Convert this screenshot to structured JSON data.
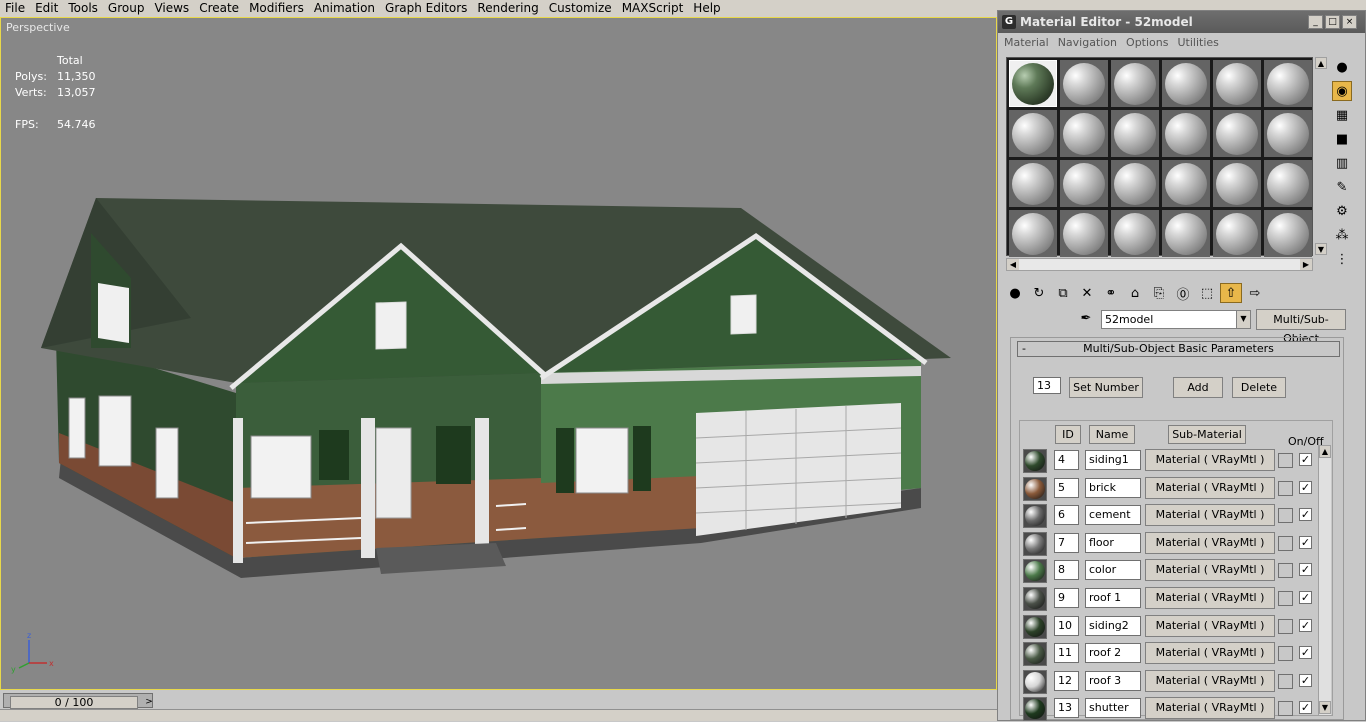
{
  "menubar": {
    "items": [
      "File",
      "Edit",
      "Tools",
      "Group",
      "Views",
      "Create",
      "Modifiers",
      "Animation",
      "Graph Editors",
      "Rendering",
      "Customize",
      "MAXScript",
      "Help"
    ]
  },
  "viewport": {
    "label": "Perspective",
    "stats": {
      "header": "Total",
      "polys_label": "Polys:",
      "polys": "11,350",
      "verts_label": "Verts:",
      "verts": "13,057",
      "fps_label": "FPS:",
      "fps": "54.746"
    },
    "axis": {
      "z": "z",
      "y": "y",
      "x": "x"
    }
  },
  "timeline": {
    "slider_label": "0 / 100",
    "next_arrow": ">"
  },
  "material_editor": {
    "title": "Material Editor - 52model",
    "title_icon": "3ds-max-icon",
    "window_buttons": [
      "_",
      "□",
      "×"
    ],
    "menu": [
      "Material",
      "Navigation",
      "Options",
      "Utilities"
    ],
    "slot_count": 24,
    "active_slot": 0,
    "side_tools": [
      "sample-type-icon",
      "backlight-icon",
      "background-icon",
      "uv-tiling-icon",
      "video-check-icon",
      "make-preview-icon",
      "options-icon",
      "select-by-material-icon",
      "material-navigator-icon"
    ],
    "toolbar": [
      "get-material-icon",
      "put-to-scene-icon",
      "assign-to-selection-icon",
      "reset-map-icon",
      "make-unique-icon",
      "put-to-library-icon",
      "material-id-channel-icon",
      "show-map-icon",
      "show-end-result-icon",
      "go-to-parent-icon",
      "go-forward-icon"
    ],
    "material_name": "52model",
    "material_type": "Multi/Sub-Object",
    "rollout_title": "Multi/Sub-Object Basic Parameters",
    "rollout_toggle": "-",
    "count": "13",
    "set_number": "Set Number",
    "add": "Add",
    "delete": "Delete",
    "headers": {
      "id": "ID",
      "name": "Name",
      "sub": "Sub-Material",
      "onoff": "On/Off"
    },
    "rows": [
      {
        "id": "4",
        "name": "siding1",
        "sub": "Material ( VRayMtl )",
        "check": "✓",
        "swatch": "#2f4a2c"
      },
      {
        "id": "5",
        "name": "brick",
        "sub": "Material ( VRayMtl )",
        "check": "✓",
        "swatch": "#8a5a3a"
      },
      {
        "id": "6",
        "name": "cement",
        "sub": "Material ( VRayMtl )",
        "check": "✓",
        "swatch": "#6a6a6a"
      },
      {
        "id": "7",
        "name": "floor",
        "sub": "Material ( VRayMtl )",
        "check": "✓",
        "swatch": "#7a7a7a"
      },
      {
        "id": "8",
        "name": "color",
        "sub": "Material ( VRayMtl )",
        "check": "✓",
        "swatch": "#4c7a4a"
      },
      {
        "id": "9",
        "name": "roof 1",
        "sub": "Material ( VRayMtl )",
        "check": "✓",
        "swatch": "#4a5048"
      },
      {
        "id": "10",
        "name": "siding2",
        "sub": "Material ( VRayMtl )",
        "check": "✓",
        "swatch": "#2c4228"
      },
      {
        "id": "11",
        "name": "roof 2",
        "sub": "Material ( VRayMtl )",
        "check": "✓",
        "swatch": "#4a5a46"
      },
      {
        "id": "12",
        "name": "roof 3",
        "sub": "Material ( VRayMtl )",
        "check": "✓",
        "swatch": "#d6d6d6"
      },
      {
        "id": "13",
        "name": "shutter",
        "sub": "Material ( VRayMtl )",
        "check": "✓",
        "swatch": "#1e3a1e"
      }
    ]
  }
}
